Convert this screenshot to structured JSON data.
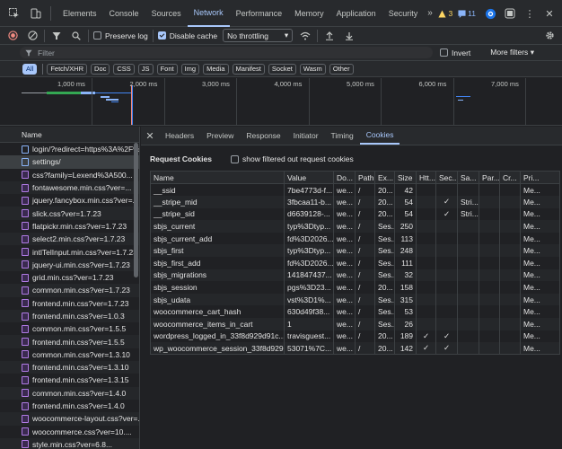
{
  "topbar": {
    "tabs": [
      "Elements",
      "Console",
      "Sources",
      "Network",
      "Performance",
      "Memory",
      "Application",
      "Security"
    ],
    "active_tab": "Network",
    "more": "»",
    "warnings": "3",
    "messages": "11"
  },
  "toolbar": {
    "preserve_log": "Preserve log",
    "disable_cache": "Disable cache",
    "throttling": "No throttling"
  },
  "filter": {
    "placeholder": "Filter",
    "invert": "Invert",
    "more_filters": "More filters"
  },
  "chips": [
    "All",
    "Fetch/XHR",
    "Doc",
    "CSS",
    "JS",
    "Font",
    "Img",
    "Media",
    "Manifest",
    "Socket",
    "Wasm",
    "Other"
  ],
  "overview": {
    "ticks": [
      "1,000 ms",
      "2,000 ms",
      "3,000 ms",
      "4,000 ms",
      "5,000 ms",
      "6,000 ms",
      "7,000 ms"
    ]
  },
  "requests": {
    "header": "Name",
    "items": [
      {
        "name": "login/?redirect=https%3A%2F%2F...",
        "type": "doc"
      },
      {
        "name": "settings/",
        "type": "doc"
      },
      {
        "name": "css?family=Lexend%3A500...",
        "type": "css"
      },
      {
        "name": "fontawesome.min.css?ver=...",
        "type": "css"
      },
      {
        "name": "jquery.fancybox.min.css?ver=...",
        "type": "css"
      },
      {
        "name": "slick.css?ver=1.7.23",
        "type": "css"
      },
      {
        "name": "flatpickr.min.css?ver=1.7.23",
        "type": "css"
      },
      {
        "name": "select2.min.css?ver=1.7.23",
        "type": "css"
      },
      {
        "name": "intlTelInput.min.css?ver=1.7.23",
        "type": "css"
      },
      {
        "name": "jquery-ui.min.css?ver=1.7.23",
        "type": "css"
      },
      {
        "name": "grid.min.css?ver=1.7.23",
        "type": "css"
      },
      {
        "name": "common.min.css?ver=1.7.23",
        "type": "css"
      },
      {
        "name": "frontend.min.css?ver=1.7.23",
        "type": "css"
      },
      {
        "name": "frontend.min.css?ver=1.0.3",
        "type": "css"
      },
      {
        "name": "common.min.css?ver=1.5.5",
        "type": "css"
      },
      {
        "name": "frontend.min.css?ver=1.5.5",
        "type": "css"
      },
      {
        "name": "common.min.css?ver=1.3.10",
        "type": "css"
      },
      {
        "name": "frontend.min.css?ver=1.3.10",
        "type": "css"
      },
      {
        "name": "frontend.min.css?ver=1.3.15",
        "type": "css"
      },
      {
        "name": "common.min.css?ver=1.4.0",
        "type": "css"
      },
      {
        "name": "frontend.min.css?ver=1.4.0",
        "type": "css"
      },
      {
        "name": "woocommerce-layout.css?ver=...",
        "type": "css"
      },
      {
        "name": "woocommerce.css?ver=10....",
        "type": "css"
      },
      {
        "name": "style.min.css?ver=6.8...",
        "type": "css"
      }
    ]
  },
  "details": {
    "tabs": [
      "Headers",
      "Preview",
      "Response",
      "Initiator",
      "Timing",
      "Cookies"
    ],
    "active_tab": "Cookies",
    "section_title": "Request Cookies",
    "show_filtered": "show filtered out request cookies",
    "columns": [
      "Name",
      "Value",
      "Do...",
      "Path",
      "Ex...",
      "Size",
      "Htt...",
      "Sec...",
      "Sa...",
      "Par...",
      "Cr...",
      "Pri..."
    ],
    "rows": [
      {
        "name": "__ssid",
        "value": "7be4773d-f...",
        "domain": "we...",
        "path": "/",
        "expires": "20...",
        "size": "42",
        "http": "",
        "secure": "",
        "samesite": "",
        "part": "",
        "cross": "",
        "prio": "Me..."
      },
      {
        "name": "__stripe_mid",
        "value": "3fbcaa11-b...",
        "domain": "we...",
        "path": "/",
        "expires": "20...",
        "size": "54",
        "http": "",
        "secure": "✓",
        "samesite": "Stri...",
        "part": "",
        "cross": "",
        "prio": "Me..."
      },
      {
        "name": "__stripe_sid",
        "value": "d6639128-...",
        "domain": "we...",
        "path": "/",
        "expires": "20...",
        "size": "54",
        "http": "",
        "secure": "✓",
        "samesite": "Stri...",
        "part": "",
        "cross": "",
        "prio": "Me..."
      },
      {
        "name": "sbjs_current",
        "value": "typ%3Dtyp...",
        "domain": "we...",
        "path": "/",
        "expires": "Ses...",
        "size": "250",
        "http": "",
        "secure": "",
        "samesite": "",
        "part": "",
        "cross": "",
        "prio": "Me..."
      },
      {
        "name": "sbjs_current_add",
        "value": "fd%3D2026...",
        "domain": "we...",
        "path": "/",
        "expires": "Ses...",
        "size": "113",
        "http": "",
        "secure": "",
        "samesite": "",
        "part": "",
        "cross": "",
        "prio": "Me..."
      },
      {
        "name": "sbjs_first",
        "value": "typ%3Dtyp...",
        "domain": "we...",
        "path": "/",
        "expires": "Ses...",
        "size": "248",
        "http": "",
        "secure": "",
        "samesite": "",
        "part": "",
        "cross": "",
        "prio": "Me..."
      },
      {
        "name": "sbjs_first_add",
        "value": "fd%3D2026...",
        "domain": "we...",
        "path": "/",
        "expires": "Ses...",
        "size": "111",
        "http": "",
        "secure": "",
        "samesite": "",
        "part": "",
        "cross": "",
        "prio": "Me..."
      },
      {
        "name": "sbjs_migrations",
        "value": "141847437...",
        "domain": "we...",
        "path": "/",
        "expires": "Ses...",
        "size": "32",
        "http": "",
        "secure": "",
        "samesite": "",
        "part": "",
        "cross": "",
        "prio": "Me..."
      },
      {
        "name": "sbjs_session",
        "value": "pgs%3D23...",
        "domain": "we...",
        "path": "/",
        "expires": "20...",
        "size": "158",
        "http": "",
        "secure": "",
        "samesite": "",
        "part": "",
        "cross": "",
        "prio": "Me..."
      },
      {
        "name": "sbjs_udata",
        "value": "vst%3D1%...",
        "domain": "we...",
        "path": "/",
        "expires": "Ses...",
        "size": "315",
        "http": "",
        "secure": "",
        "samesite": "",
        "part": "",
        "cross": "",
        "prio": "Me..."
      },
      {
        "name": "woocommerce_cart_hash",
        "value": "630d49f38...",
        "domain": "we...",
        "path": "/",
        "expires": "Ses...",
        "size": "53",
        "http": "",
        "secure": "",
        "samesite": "",
        "part": "",
        "cross": "",
        "prio": "Me..."
      },
      {
        "name": "woocommerce_items_in_cart",
        "value": "1",
        "domain": "we...",
        "path": "/",
        "expires": "Ses...",
        "size": "26",
        "http": "",
        "secure": "",
        "samesite": "",
        "part": "",
        "cross": "",
        "prio": "Me..."
      },
      {
        "name": "wordpress_logged_in_33f8d929d91c...",
        "value": "travisguest...",
        "domain": "we...",
        "path": "/",
        "expires": "20...",
        "size": "189",
        "http": "✓",
        "secure": "✓",
        "samesite": "",
        "part": "",
        "cross": "",
        "prio": "Me..."
      },
      {
        "name": "wp_woocommerce_session_33f8d929...",
        "value": "53071%7C...",
        "domain": "we...",
        "path": "/",
        "expires": "20...",
        "size": "142",
        "http": "✓",
        "secure": "✓",
        "samesite": "",
        "part": "",
        "cross": "",
        "prio": "Me..."
      }
    ]
  }
}
